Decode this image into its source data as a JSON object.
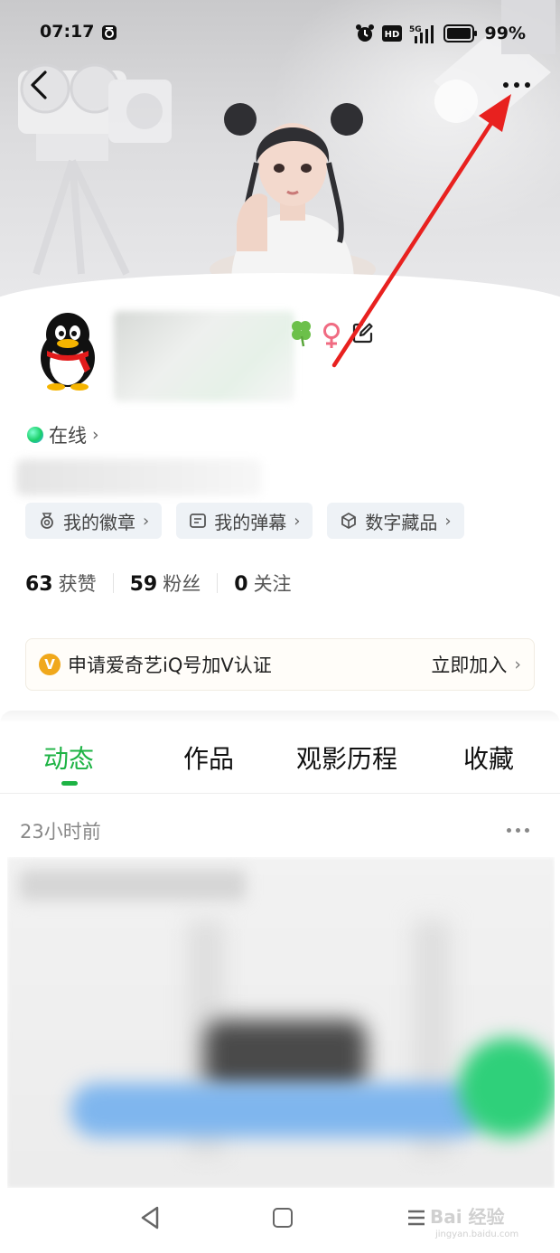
{
  "status_bar": {
    "time": "07:17",
    "network": "5G",
    "hd": "HD",
    "battery": "99%"
  },
  "profile": {
    "online_label": "在线",
    "chips": [
      {
        "icon": "badge-icon",
        "label": "我的徽章"
      },
      {
        "icon": "danmaku-icon",
        "label": "我的弹幕"
      },
      {
        "icon": "cube-icon",
        "label": "数字藏品"
      }
    ],
    "stats": [
      {
        "num": "63",
        "label": "获赞"
      },
      {
        "num": "59",
        "label": "粉丝"
      },
      {
        "num": "0",
        "label": "关注"
      }
    ]
  },
  "vip": {
    "badge": "V",
    "text": "申请爱奇艺iQ号加V认证",
    "action": "立即加入"
  },
  "tabs": [
    "动态",
    "作品",
    "观影历程",
    "收藏"
  ],
  "active_tab": "动态",
  "feed": {
    "post_time": "23小时前"
  },
  "watermark": {
    "brand": "Bai 经验",
    "url": "jingyan.baidu.com"
  },
  "colors": {
    "accent": "#1db344",
    "vip_gold": "#f0a81c",
    "annotation": "#e8211f"
  }
}
